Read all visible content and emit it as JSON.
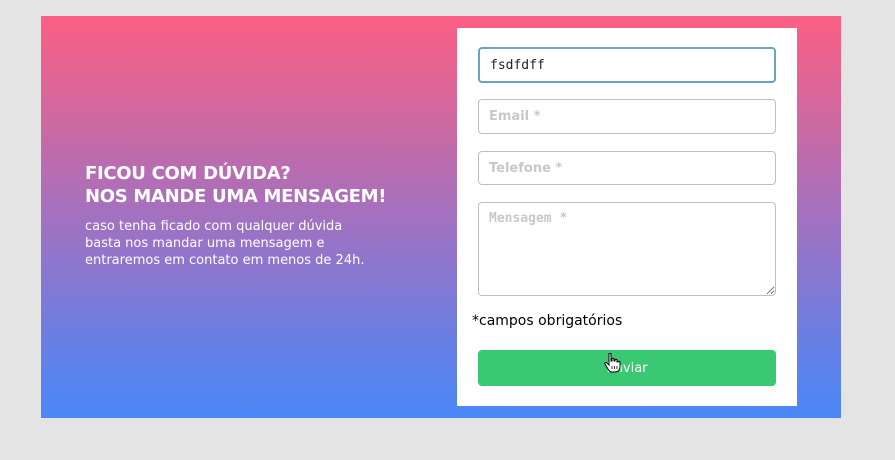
{
  "info": {
    "title_line1": "FICOU COM DÚVIDA?",
    "title_line2": "NOS MANDE UMA MENSAGEM!",
    "text_line1": "caso tenha ficado com qualquer dúvida",
    "text_line2": "basta nos mandar uma mensagem e",
    "text_line3": "entraremos em contato em menos de 24h."
  },
  "form": {
    "name_value": "fsdfdff",
    "email_placeholder": "Email *",
    "phone_placeholder": "Telefone *",
    "message_placeholder": "Mensagem *",
    "required_note": "*campos obrigatórios",
    "submit_label": "Enviar"
  },
  "colors": {
    "gradient_top": "#fc5f84",
    "gradient_bottom": "#4a87f8",
    "submit_bg": "#3bc873",
    "focus_border": "#6aa3c8"
  },
  "icons": {
    "cursor": "hand-pointer-icon"
  }
}
